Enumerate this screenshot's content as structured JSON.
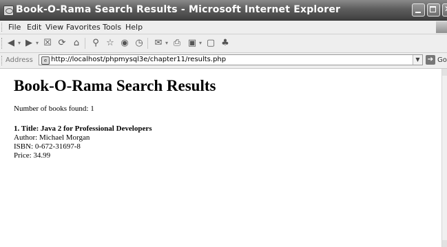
{
  "window": {
    "title": "Book-O-Rama Search Results - Microsoft Internet Explorer"
  },
  "menu": {
    "items": [
      "File",
      "Edit",
      "View",
      "Favorites",
      "Tools",
      "Help"
    ]
  },
  "toolbar": {
    "icons": [
      "back-icon",
      "forward-icon",
      "stop-icon",
      "refresh-icon",
      "home-icon",
      "search-icon",
      "favorites-icon",
      "media-icon",
      "history-icon",
      "mail-icon",
      "print-icon",
      "edit-icon",
      "discuss-icon",
      "messenger-icon"
    ]
  },
  "address": {
    "label": "Address",
    "url": "http://localhost/phpmysql3e/chapter11/results.php",
    "go_label": "Go"
  },
  "page": {
    "heading": "Book-O-Rama Search Results",
    "count_text": "Number of books found: 1",
    "book": {
      "title": "1. Title: Java 2 for Professional Developers",
      "author": "Author: Michael Morgan",
      "isbn": "ISBN: 0-672-31697-8",
      "price": "Price: 34.99"
    }
  }
}
